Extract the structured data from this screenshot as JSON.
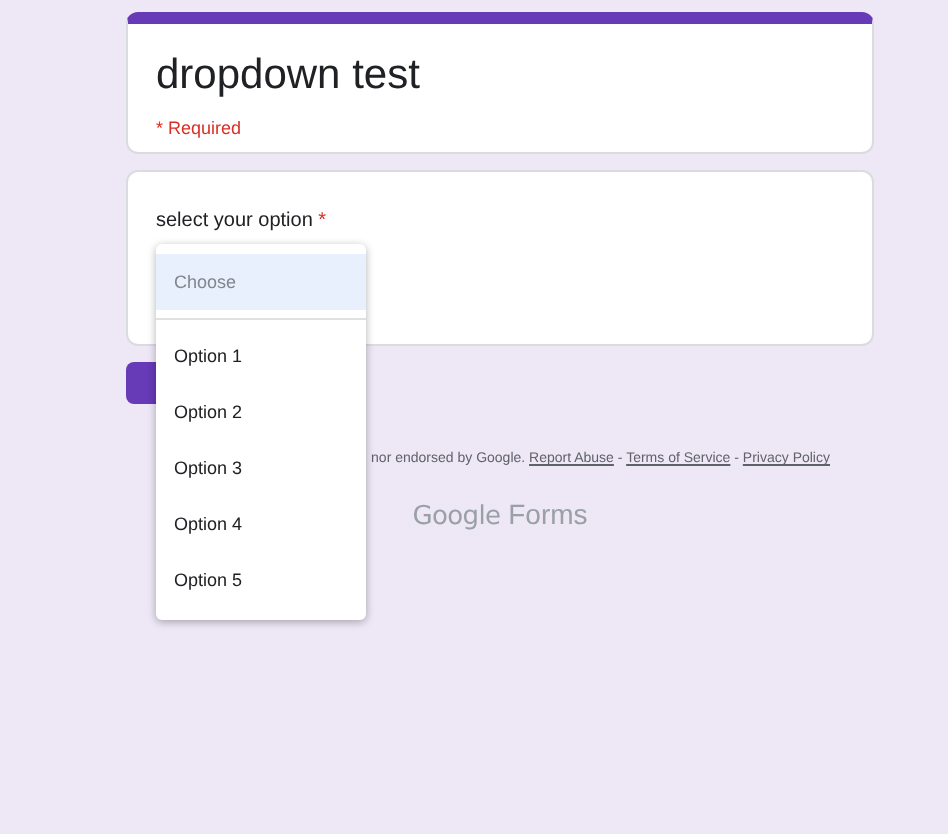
{
  "form": {
    "title": "dropdown test",
    "required_note": "* Required"
  },
  "question": {
    "label": "select your option",
    "required": true,
    "required_mark": "*"
  },
  "dropdown_menu": {
    "expanded": true,
    "items": [
      {
        "kind": "placeholder",
        "label": "Choose",
        "selected": true
      },
      {
        "kind": "option",
        "label": "Option 1",
        "selected": false
      },
      {
        "kind": "option",
        "label": "Option 2",
        "selected": false
      },
      {
        "kind": "option",
        "label": "Option 3",
        "selected": false
      },
      {
        "kind": "option",
        "label": "Option 4",
        "selected": false
      },
      {
        "kind": "option",
        "label": "Option 5",
        "selected": false
      }
    ]
  },
  "footer": [
    {
      "kind": "text",
      "text": "nor endorsed by Google. "
    },
    {
      "kind": "link",
      "text": "Report Abuse"
    },
    {
      "kind": "text",
      "text": " - "
    },
    {
      "kind": "link",
      "text": "Terms of Service"
    },
    {
      "kind": "text",
      "text": " - "
    },
    {
      "kind": "link",
      "text": "Privacy Policy"
    }
  ],
  "logo": {
    "brand": "Google",
    "product": "Forms"
  }
}
